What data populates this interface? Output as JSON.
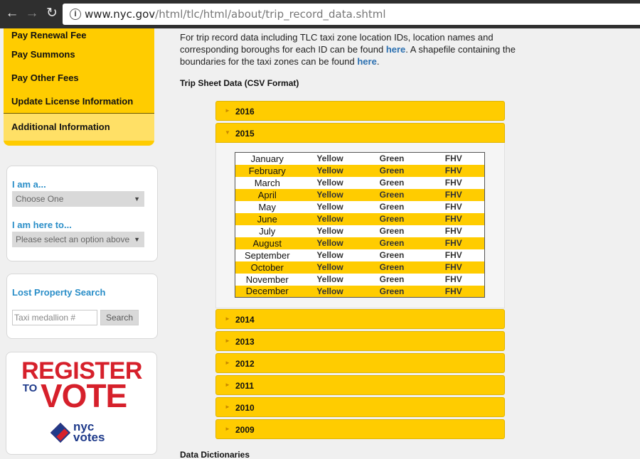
{
  "browser": {
    "url_host": "www.nyc.gov",
    "url_path": "/html/tlc/html/about/trip_record_data.shtml"
  },
  "leftnav": {
    "items": [
      {
        "label": "Pay Renewal Fee"
      },
      {
        "label": "Pay Summons"
      },
      {
        "label": "Pay Other Fees"
      },
      {
        "label": "Update License Information"
      },
      {
        "label": "Additional Information"
      }
    ]
  },
  "iam": {
    "label1": "I am a...",
    "select1": "Choose One",
    "label2": "I am here to...",
    "select2": "Please select an option above"
  },
  "lost_property": {
    "title": "Lost Property Search",
    "placeholder": "Taxi medallion #",
    "button": "Search"
  },
  "vote": {
    "register": "REGISTER",
    "to": "TO",
    "vote": "VOTE",
    "nyc": "nyc",
    "votes": "votes"
  },
  "intro": {
    "text1": "For trip record data including TLC taxi zone location IDs, location names and corresponding boroughs for each ID can be found ",
    "link1": "here",
    "text2": ". A shapefile containing the boundaries for the taxi zones can be found ",
    "link2": "here",
    "text3": "."
  },
  "section_trip": "Trip Sheet Data (CSV Format)",
  "section_dict": "Data Dictionaries",
  "years": [
    "2016",
    "2015",
    "2014",
    "2013",
    "2012",
    "2011",
    "2010",
    "2009"
  ],
  "table": {
    "links": [
      "Yellow",
      "Green",
      "FHV"
    ],
    "months": [
      "January",
      "February",
      "March",
      "April",
      "May",
      "June",
      "July",
      "August",
      "September",
      "October",
      "November",
      "December"
    ]
  },
  "colors": {
    "accent": "#ffcc00",
    "link": "#2a8ec8",
    "vote_red": "#d6202b",
    "vote_blue": "#1e3a8a"
  }
}
